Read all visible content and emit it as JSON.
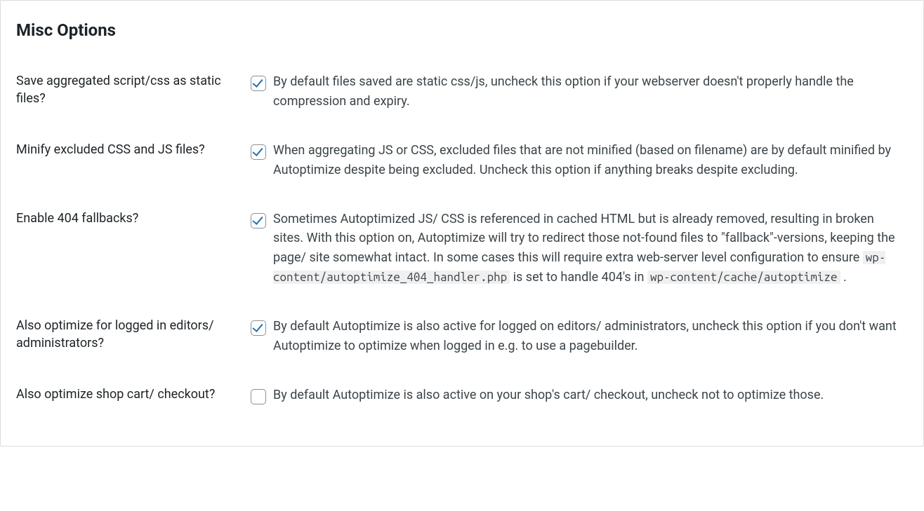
{
  "section": {
    "title": "Misc Options",
    "options": [
      {
        "label": "Save aggregated script/css as static files?",
        "checked": true,
        "desc": "By default files saved are static css/js, uncheck this option if your webserver doesn't properly handle the compression and expiry."
      },
      {
        "label": "Minify excluded CSS and JS files?",
        "checked": true,
        "desc": "When aggregating JS or CSS, excluded files that are not minified (based on filename) are by default minified by Autoptimize despite being excluded. Uncheck this option if anything breaks despite excluding."
      },
      {
        "label": "Enable 404 fallbacks?",
        "checked": true,
        "desc_parts": [
          {
            "type": "text",
            "value": "Sometimes Autoptimized JS/ CSS is referenced in cached HTML but is already removed, resulting in broken sites. With this option on, Autoptimize will try to redirect those not-found files to \"fallback\"-versions, keeping the page/ site somewhat intact. In some cases this will require extra web-server level configuration to ensure "
          },
          {
            "type": "code",
            "value": "wp-content/autoptimize_404_handler.php"
          },
          {
            "type": "text",
            "value": " is set to handle 404's in "
          },
          {
            "type": "code",
            "value": "wp-content/cache/autoptimize"
          },
          {
            "type": "text",
            "value": " ."
          }
        ]
      },
      {
        "label": "Also optimize for logged in editors/ administrators?",
        "checked": true,
        "desc": "By default Autoptimize is also active for logged on editors/ administrators, uncheck this option if you don't want Autoptimize to optimize when logged in e.g. to use a pagebuilder."
      },
      {
        "label": "Also optimize shop cart/ checkout?",
        "checked": false,
        "desc": "By default Autoptimize is also active on your shop's cart/ checkout, uncheck not to optimize those."
      }
    ]
  }
}
